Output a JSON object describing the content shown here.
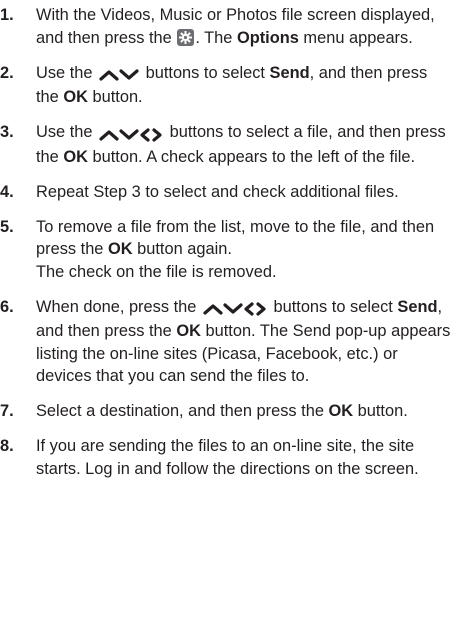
{
  "steps": [
    {
      "num": "1.",
      "p1": "With the Videos, Music or Photos file screen displayed, and then press the ",
      "icon": "gear-icon",
      "p2": ". The ",
      "b1": "Options",
      "p3": " menu appears."
    },
    {
      "num": "2.",
      "p1": "Use the ",
      "icons": [
        "up-arrow-icon",
        "down-arrow-icon"
      ],
      "p2": " buttons to select ",
      "b1": "Send",
      "p3": ", and then press the ",
      "b2": "OK",
      "p4": " button."
    },
    {
      "num": "3.",
      "p1": "Use the ",
      "icons": [
        "up-arrow-icon",
        "down-arrow-icon",
        "left-arrow-icon",
        "right-arrow-icon"
      ],
      "p2": " buttons to select a file, and then press the ",
      "b1": "OK",
      "p3": " button. A check appears to the left of the file."
    },
    {
      "num": "4.",
      "text": "Repeat Step 3 to select and check additional files."
    },
    {
      "num": "5.",
      "p1": "To remove a file from the list, move to the file, and then press the ",
      "b1": "OK",
      "p2": " button again.",
      "p3": "The check on the file is removed."
    },
    {
      "num": "6.",
      "p1": "When done, press the ",
      "icons": [
        "up-arrow-icon",
        "down-arrow-icon",
        "left-arrow-icon",
        "right-arrow-icon"
      ],
      "p2": " buttons to select ",
      "b1": "Send",
      "p3": ", and then press the ",
      "b2": "OK",
      "p4": " button. The Send pop-up appears listing the on-line sites (Picasa, Facebook, etc.) or devices that you can send the files to."
    },
    {
      "num": "7.",
      "p1": "Select a destination, and then press the ",
      "b1": "OK",
      "p2": " button."
    },
    {
      "num": "8.",
      "text": "If you are sending the files to an on-line site, the site starts. Log in and follow the directions on the screen."
    }
  ]
}
